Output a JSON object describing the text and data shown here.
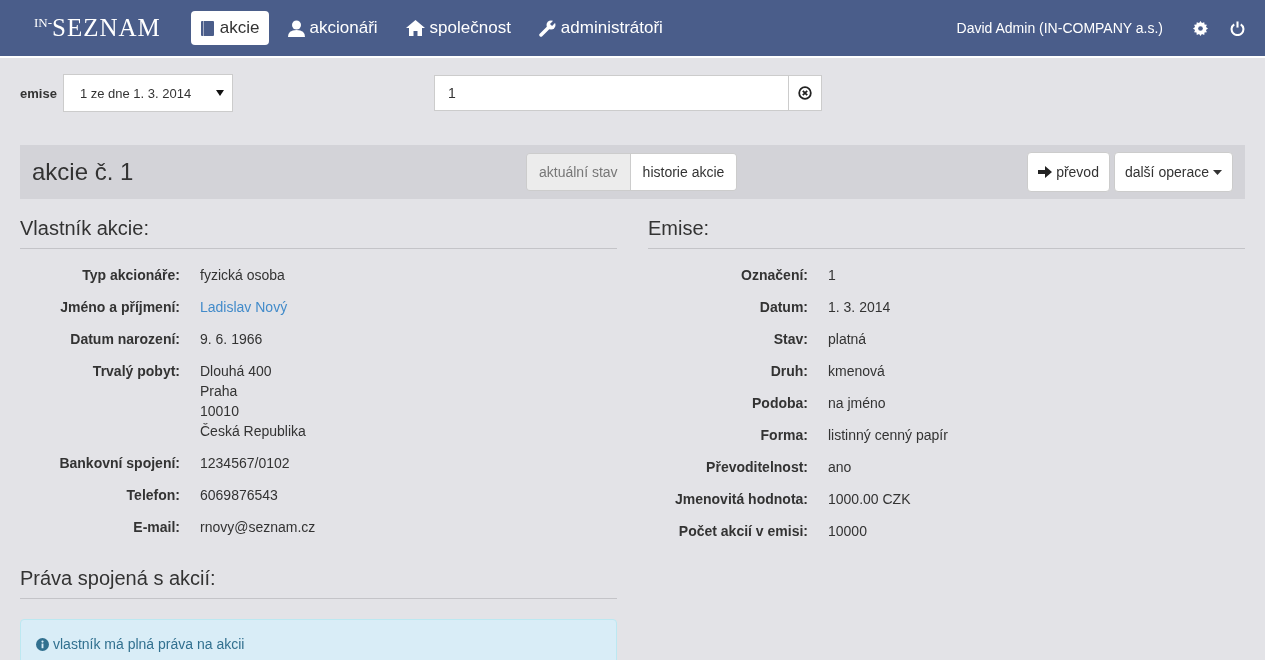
{
  "navbar": {
    "logo": {
      "prefix": "IN-",
      "name": "SEZNAM"
    },
    "items": [
      {
        "label": "akcie",
        "kind": "book",
        "selected": true
      },
      {
        "label": "akcionáři",
        "kind": "user",
        "selected": false
      },
      {
        "label": "společnost",
        "kind": "home",
        "selected": false
      },
      {
        "label": "administrátoři",
        "kind": "wrench",
        "selected": false
      }
    ],
    "user": "David Admin (IN-COMPANY a.s.)"
  },
  "filter": {
    "label": "emise",
    "value": "1 ze dne 1. 3. 2014"
  },
  "search": {
    "value": "1"
  },
  "header": {
    "title": "akcie č. 1",
    "tabs": [
      {
        "label": "aktuální stav",
        "selected": true
      },
      {
        "label": "historie akcie",
        "selected": false
      }
    ],
    "buttons": [
      {
        "label": "převod",
        "kind": "arrow"
      },
      {
        "label": "další operace",
        "kind": "dropdown"
      }
    ]
  },
  "owner": {
    "title": "Vlastník akcie:",
    "fields": [
      {
        "label": "Typ akcionáře:",
        "lines": [
          "fyzická osoba"
        ],
        "kind": "text"
      },
      {
        "label": "Jméno a příjmení:",
        "lines": [
          "Ladislav Nový"
        ],
        "kind": "link"
      },
      {
        "label": "Datum narození:",
        "lines": [
          "9. 6. 1966"
        ],
        "kind": "text"
      },
      {
        "label": "Trvalý pobyt:",
        "lines": [
          "Dlouhá 400",
          "Praha",
          "10010",
          "Česká Republika"
        ],
        "kind": "text"
      },
      {
        "label": "Bankovní spojení:",
        "lines": [
          "1234567/0102"
        ],
        "kind": "text"
      },
      {
        "label": "Telefon:",
        "lines": [
          "6069876543"
        ],
        "kind": "text"
      },
      {
        "label": "E-mail:",
        "lines": [
          "rnovy@seznam.cz"
        ],
        "kind": "text"
      }
    ]
  },
  "rights": {
    "title": "Práva spojená s akcií:",
    "message": "vlastník má plná práva na akcii"
  },
  "issue": {
    "title": "Emise:",
    "fields": [
      {
        "label": "Označení:",
        "lines": [
          "1"
        ],
        "kind": "text"
      },
      {
        "label": "Datum:",
        "lines": [
          "1. 3. 2014"
        ],
        "kind": "text"
      },
      {
        "label": "Stav:",
        "lines": [
          "platná"
        ],
        "kind": "text"
      },
      {
        "label": "Druh:",
        "lines": [
          "kmenová"
        ],
        "kind": "text"
      },
      {
        "label": "Podoba:",
        "lines": [
          "na jméno"
        ],
        "kind": "text"
      },
      {
        "label": "Forma:",
        "lines": [
          "listinný cenný papír"
        ],
        "kind": "text"
      },
      {
        "label": "Převoditelnost:",
        "lines": [
          "ano"
        ],
        "kind": "text"
      },
      {
        "label": "Jmenovitá hodnota:",
        "lines": [
          "1000.00 CZK"
        ],
        "kind": "text"
      },
      {
        "label": "Počet akcií v emisi:",
        "lines": [
          "10000"
        ],
        "kind": "text"
      }
    ]
  }
}
